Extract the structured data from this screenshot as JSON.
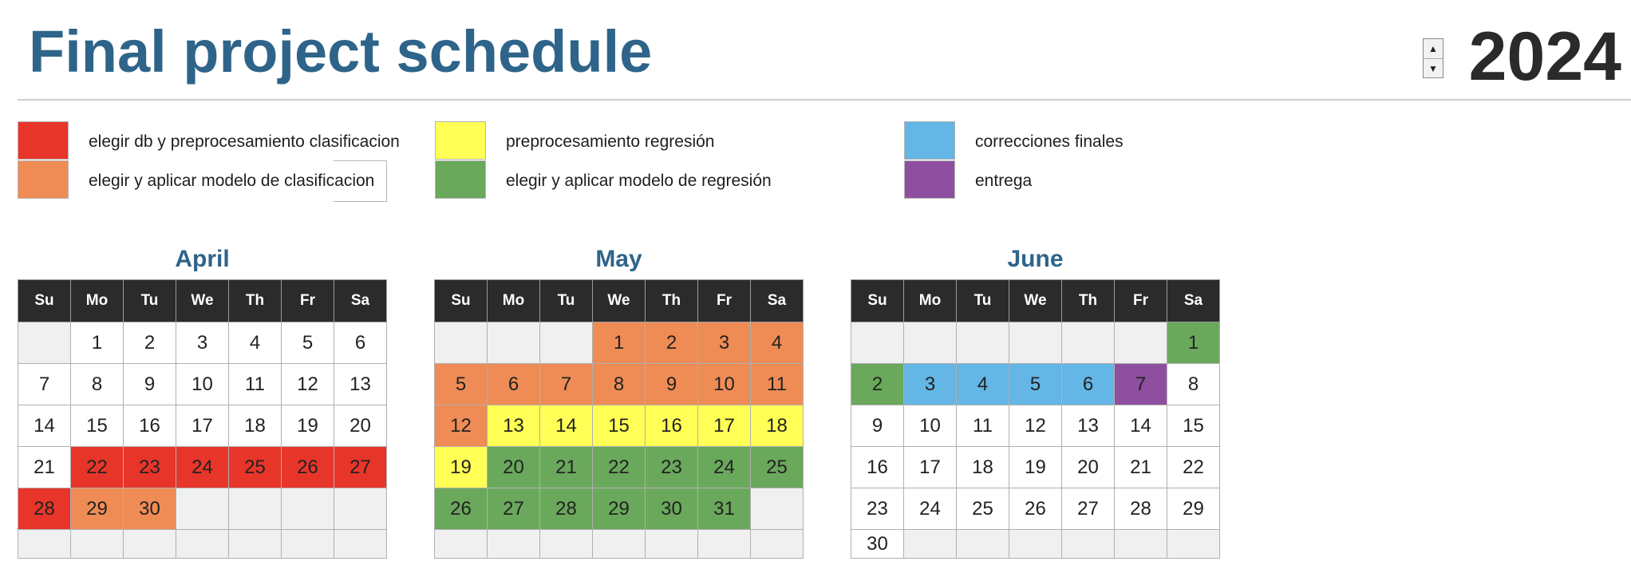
{
  "title": "Final project schedule",
  "year": "2024",
  "spinner": {
    "up_glyph": "▲",
    "down_glyph": "▼"
  },
  "colors": {
    "red": "#e8352a",
    "orange": "#ef8c55",
    "yellow": "#ffff55",
    "green": "#6aa85c",
    "blue": "#63b6e6",
    "purple": "#8f4fa0",
    "title": "#2e6489"
  },
  "legend": [
    {
      "color": "red",
      "label": "elegir db y preprocesamiento clasificacion"
    },
    {
      "color": "orange",
      "label": "elegir y aplicar modelo de clasificacion"
    },
    {
      "color": "yellow",
      "label": "preprocesamiento regresión"
    },
    {
      "color": "green",
      "label": "elegir y aplicar modelo de regresión"
    },
    {
      "color": "blue",
      "label": "correcciones finales"
    },
    {
      "color": "purple",
      "label": "entrega"
    }
  ],
  "weekdays": [
    "Su",
    "Mo",
    "Tu",
    "We",
    "Th",
    "Fr",
    "Sa"
  ],
  "months": [
    {
      "name": "April",
      "weeks": [
        [
          null,
          1,
          2,
          3,
          4,
          5,
          6
        ],
        [
          7,
          8,
          9,
          10,
          11,
          12,
          13
        ],
        [
          14,
          15,
          16,
          17,
          18,
          19,
          20
        ],
        [
          21,
          22,
          23,
          24,
          25,
          26,
          27
        ],
        [
          28,
          29,
          30,
          null,
          null,
          null,
          null
        ],
        [
          null,
          null,
          null,
          null,
          null,
          null,
          null
        ]
      ],
      "highlights": {
        "22": "red",
        "23": "red",
        "24": "red",
        "25": "red",
        "26": "red",
        "27": "red",
        "28": "red",
        "29": "orange",
        "30": "orange"
      }
    },
    {
      "name": "May",
      "weeks": [
        [
          null,
          null,
          null,
          1,
          2,
          3,
          4
        ],
        [
          5,
          6,
          7,
          8,
          9,
          10,
          11
        ],
        [
          12,
          13,
          14,
          15,
          16,
          17,
          18
        ],
        [
          19,
          20,
          21,
          22,
          23,
          24,
          25
        ],
        [
          26,
          27,
          28,
          29,
          30,
          31,
          null
        ],
        [
          null,
          null,
          null,
          null,
          null,
          null,
          null
        ]
      ],
      "highlights": {
        "1": "orange",
        "2": "orange",
        "3": "orange",
        "4": "orange",
        "5": "orange",
        "6": "orange",
        "7": "orange",
        "8": "orange",
        "9": "orange",
        "10": "orange",
        "11": "orange",
        "12": "orange",
        "13": "yellow",
        "14": "yellow",
        "15": "yellow",
        "16": "yellow",
        "17": "yellow",
        "18": "yellow",
        "19": "yellow",
        "20": "green",
        "21": "green",
        "22": "green",
        "23": "green",
        "24": "green",
        "25": "green",
        "26": "green",
        "27": "green",
        "28": "green",
        "29": "green",
        "30": "green",
        "31": "green"
      }
    },
    {
      "name": "June",
      "weeks": [
        [
          null,
          null,
          null,
          null,
          null,
          null,
          1
        ],
        [
          2,
          3,
          4,
          5,
          6,
          7,
          8
        ],
        [
          9,
          10,
          11,
          12,
          13,
          14,
          15
        ],
        [
          16,
          17,
          18,
          19,
          20,
          21,
          22
        ],
        [
          23,
          24,
          25,
          26,
          27,
          28,
          29
        ],
        [
          30,
          null,
          null,
          null,
          null,
          null,
          null
        ]
      ],
      "highlights": {
        "1": "green",
        "2": "green",
        "3": "blue",
        "4": "blue",
        "5": "blue",
        "6": "blue",
        "7": "purple"
      }
    }
  ]
}
